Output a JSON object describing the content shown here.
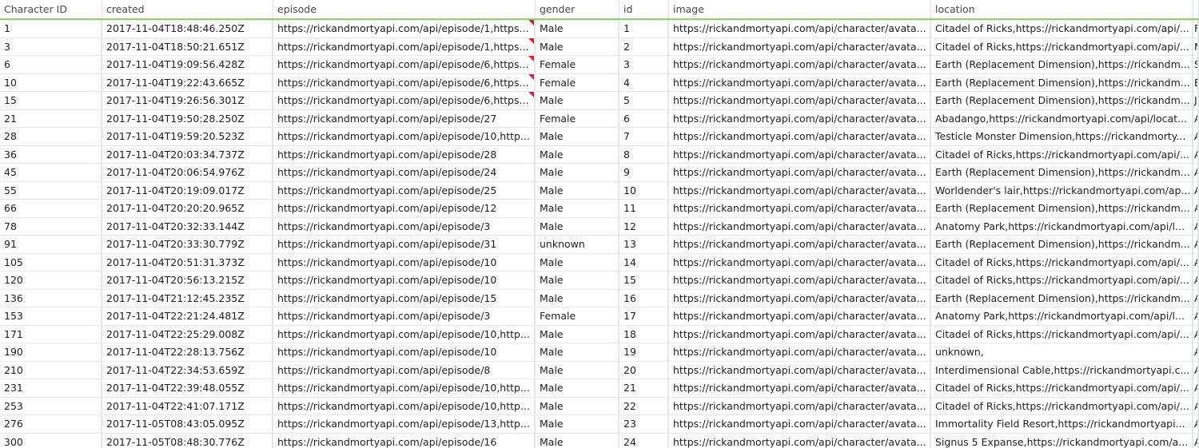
{
  "columns": [
    "Character ID",
    "created",
    "episode",
    "gender",
    "id",
    "image",
    "location",
    ""
  ],
  "rows": [
    {
      "cells": [
        "1",
        "2017-11-04T18:48:46.250Z",
        "https://rickandmortyapi.com/api/episode/1,https...",
        "Male",
        "1",
        "https://rickandmortyapi.com/api/character/avata...",
        "Citadel of Ricks,https://rickandmortyapi.com/api/...",
        "F"
      ],
      "flag": true
    },
    {
      "cells": [
        "3",
        "2017-11-04T18:50:21.651Z",
        "https://rickandmortyapi.com/api/episode/1,https...",
        "Male",
        "2",
        "https://rickandmortyapi.com/api/character/avata...",
        "Citadel of Ricks,https://rickandmortyapi.com/api/...",
        "M"
      ],
      "flag": true
    },
    {
      "cells": [
        "6",
        "2017-11-04T19:09:56.428Z",
        "https://rickandmortyapi.com/api/episode/6,https...",
        "Female",
        "3",
        "https://rickandmortyapi.com/api/character/avata...",
        "Earth (Replacement Dimension),https://rickandm...",
        "S"
      ],
      "flag": true
    },
    {
      "cells": [
        "10",
        "2017-11-04T19:22:43.665Z",
        "https://rickandmortyapi.com/api/episode/6,https...",
        "Female",
        "4",
        "https://rickandmortyapi.com/api/character/avata...",
        "Earth (Replacement Dimension),https://rickandm...",
        "B"
      ],
      "flag": true
    },
    {
      "cells": [
        "15",
        "2017-11-04T19:26:56.301Z",
        "https://rickandmortyapi.com/api/episode/6,https...",
        "Male",
        "5",
        "https://rickandmortyapi.com/api/character/avata...",
        "Earth (Replacement Dimension),https://rickandm...",
        "J"
      ],
      "flag": true
    },
    {
      "cells": [
        "21",
        "2017-11-04T19:50:28.250Z",
        "https://rickandmortyapi.com/api/episode/27",
        "Female",
        "6",
        "https://rickandmortyapi.com/api/character/avata...",
        "Abadango,https://rickandmortyapi.com/api/locat...",
        "A"
      ],
      "flag": false
    },
    {
      "cells": [
        "28",
        "2017-11-04T19:59:20.523Z",
        "https://rickandmortyapi.com/api/episode/10,http...",
        "Male",
        "7",
        "https://rickandmortyapi.com/api/character/avata...",
        "Testicle Monster Dimension,https://rickandmorty...",
        "A"
      ],
      "flag": false
    },
    {
      "cells": [
        "36",
        "2017-11-04T20:03:34.737Z",
        "https://rickandmortyapi.com/api/episode/28",
        "Male",
        "8",
        "https://rickandmortyapi.com/api/character/avata...",
        "Citadel of Ricks,https://rickandmortyapi.com/api/...",
        "A"
      ],
      "flag": false
    },
    {
      "cells": [
        "45",
        "2017-11-04T20:06:54.976Z",
        "https://rickandmortyapi.com/api/episode/24",
        "Male",
        "9",
        "https://rickandmortyapi.com/api/character/avata...",
        "Earth (Replacement Dimension),https://rickandm...",
        "A"
      ],
      "flag": false
    },
    {
      "cells": [
        "55",
        "2017-11-04T20:19:09.017Z",
        "https://rickandmortyapi.com/api/episode/25",
        "Male",
        "10",
        "https://rickandmortyapi.com/api/character/avata...",
        "Worldender's lair,https://rickandmortyapi.com/ap...",
        "A"
      ],
      "flag": false
    },
    {
      "cells": [
        "66",
        "2017-11-04T20:20:20.965Z",
        "https://rickandmortyapi.com/api/episode/12",
        "Male",
        "11",
        "https://rickandmortyapi.com/api/character/avata...",
        "Earth (Replacement Dimension),https://rickandm...",
        "A"
      ],
      "flag": false
    },
    {
      "cells": [
        "78",
        "2017-11-04T20:32:33.144Z",
        "https://rickandmortyapi.com/api/episode/3",
        "Male",
        "12",
        "https://rickandmortyapi.com/api/character/avata...",
        "Anatomy Park,https://rickandmortyapi.com/api/l...",
        "A"
      ],
      "flag": false
    },
    {
      "cells": [
        "91",
        "2017-11-04T20:33:30.779Z",
        "https://rickandmortyapi.com/api/episode/31",
        "unknown",
        "13",
        "https://rickandmortyapi.com/api/character/avata...",
        "Earth (Replacement Dimension),https://rickandm...",
        "A"
      ],
      "flag": false
    },
    {
      "cells": [
        "105",
        "2017-11-04T20:51:31.373Z",
        "https://rickandmortyapi.com/api/episode/10",
        "Male",
        "14",
        "https://rickandmortyapi.com/api/character/avata...",
        "Citadel of Ricks,https://rickandmortyapi.com/api/...",
        "A"
      ],
      "flag": false
    },
    {
      "cells": [
        "120",
        "2017-11-04T20:56:13.215Z",
        "https://rickandmortyapi.com/api/episode/10",
        "Male",
        "15",
        "https://rickandmortyapi.com/api/character/avata...",
        "Citadel of Ricks,https://rickandmortyapi.com/api/...",
        "A"
      ],
      "flag": false
    },
    {
      "cells": [
        "136",
        "2017-11-04T21:12:45.235Z",
        "https://rickandmortyapi.com/api/episode/15",
        "Male",
        "16",
        "https://rickandmortyapi.com/api/character/avata...",
        "Earth (Replacement Dimension),https://rickandm...",
        "A"
      ],
      "flag": false
    },
    {
      "cells": [
        "153",
        "2017-11-04T22:21:24.481Z",
        "https://rickandmortyapi.com/api/episode/3",
        "Female",
        "17",
        "https://rickandmortyapi.com/api/character/avata...",
        "Anatomy Park,https://rickandmortyapi.com/api/l...",
        "A"
      ],
      "flag": false
    },
    {
      "cells": [
        "171",
        "2017-11-04T22:25:29.008Z",
        "https://rickandmortyapi.com/api/episode/10,http...",
        "Male",
        "18",
        "https://rickandmortyapi.com/api/character/avata...",
        "Citadel of Ricks,https://rickandmortyapi.com/api/...",
        "A"
      ],
      "flag": false
    },
    {
      "cells": [
        "190",
        "2017-11-04T22:28:13.756Z",
        "https://rickandmortyapi.com/api/episode/10",
        "Male",
        "19",
        "https://rickandmortyapi.com/api/character/avata...",
        "unknown,",
        "A"
      ],
      "flag": false
    },
    {
      "cells": [
        "210",
        "2017-11-04T22:34:53.659Z",
        "https://rickandmortyapi.com/api/episode/8",
        "Male",
        "20",
        "https://rickandmortyapi.com/api/character/avata...",
        "Interdimensional Cable,https://rickandmortyapi.c...",
        "A"
      ],
      "flag": false
    },
    {
      "cells": [
        "231",
        "2017-11-04T22:39:48.055Z",
        "https://rickandmortyapi.com/api/episode/10,http...",
        "Male",
        "21",
        "https://rickandmortyapi.com/api/character/avata...",
        "Citadel of Ricks,https://rickandmortyapi.com/api/...",
        "A"
      ],
      "flag": false
    },
    {
      "cells": [
        "253",
        "2017-11-04T22:41:07.171Z",
        "https://rickandmortyapi.com/api/episode/10,http...",
        "Male",
        "22",
        "https://rickandmortyapi.com/api/character/avata...",
        "Citadel of Ricks,https://rickandmortyapi.com/api/...",
        "A"
      ],
      "flag": false
    },
    {
      "cells": [
        "276",
        "2017-11-05T08:43:05.095Z",
        "https://rickandmortyapi.com/api/episode/13,http...",
        "Male",
        "23",
        "https://rickandmortyapi.com/api/character/avata...",
        "Immortality Field Resort,https://rickandmortyapi...",
        "A"
      ],
      "flag": false
    },
    {
      "cells": [
        "300",
        "2017-11-05T08:48:30.776Z",
        "https://rickandmortyapi.com/api/episode/16",
        "Male",
        "24",
        "https://rickandmortyapi.com/api/character/avata...",
        "Signus 5 Expanse,https://rickandmortyapi.com/a...",
        "A"
      ],
      "flag": false
    }
  ],
  "colors": {
    "header_border": "#8ed46a",
    "grid_line": "#e4e8ee",
    "flag": "#e02020"
  }
}
